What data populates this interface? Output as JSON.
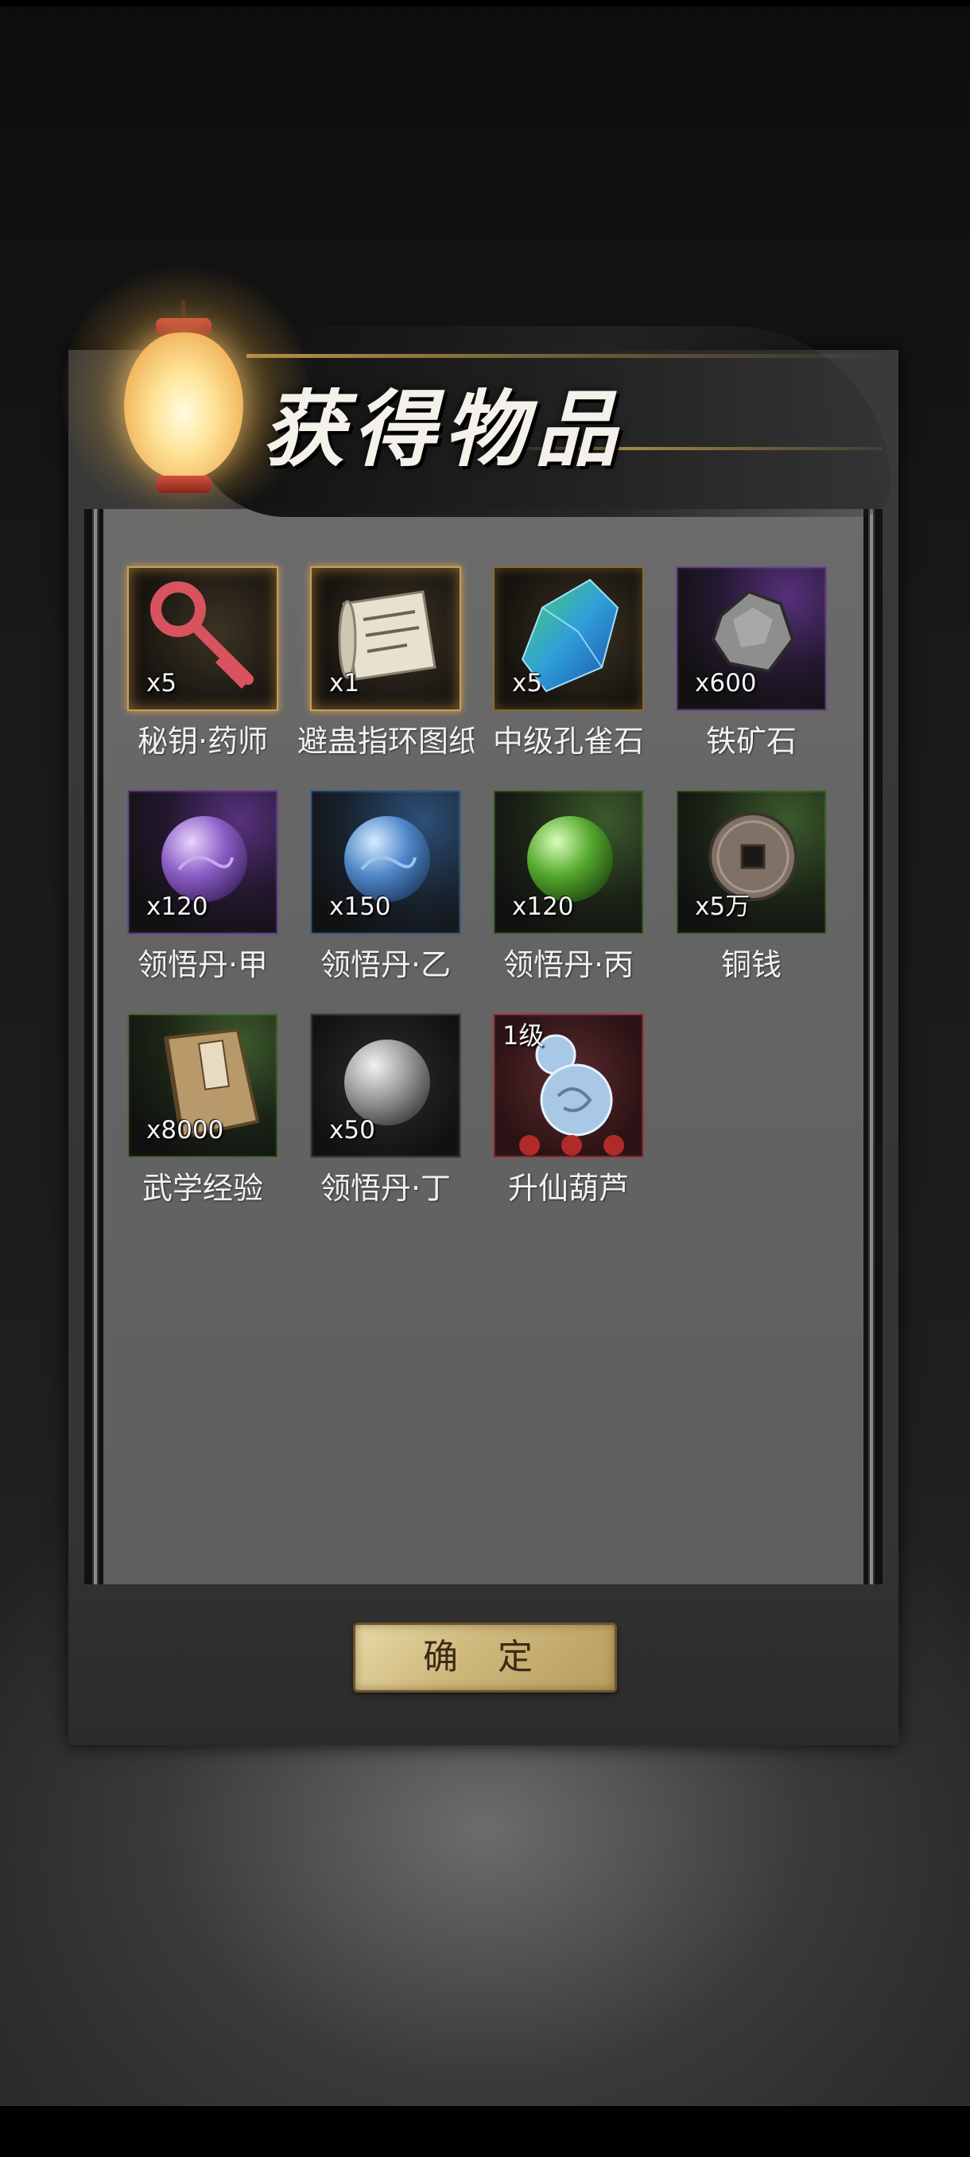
{
  "dialog": {
    "title": "获得物品",
    "confirm_label": "确 定"
  },
  "items": [
    {
      "name": "秘钥·药师",
      "qty": "x5",
      "quality": "gold",
      "icon": "key-icon",
      "accent": "#d9535f"
    },
    {
      "name": "避蛊指环图纸",
      "qty": "x1",
      "quality": "gold",
      "icon": "scroll-icon",
      "accent": "#e8e1d0"
    },
    {
      "name": "中级孔雀石",
      "qty": "x5",
      "quality": "gold",
      "icon": "crystal-icon",
      "accent": "#3fa8d8"
    },
    {
      "name": "铁矿石",
      "qty": "x600",
      "quality": "purple",
      "icon": "iron-ore-icon",
      "accent": "#9a9a9a"
    },
    {
      "name": "领悟丹·甲",
      "qty": "x120",
      "quality": "purple",
      "icon": "pill-icon",
      "accent": "#8a5cc4"
    },
    {
      "name": "领悟丹·乙",
      "qty": "x150",
      "quality": "blue",
      "icon": "pill-icon",
      "accent": "#4f86c8"
    },
    {
      "name": "领悟丹·丙",
      "qty": "x120",
      "quality": "green",
      "icon": "pill-icon",
      "accent": "#55a72e"
    },
    {
      "name": "铜钱",
      "qty": "x5万",
      "quality": "green",
      "icon": "coin-icon",
      "accent": "#8a7c70"
    },
    {
      "name": "武学经验",
      "qty": "x8000",
      "quality": "green",
      "icon": "book-icon",
      "accent": "#b89a6a"
    },
    {
      "name": "领悟丹·丁",
      "qty": "x50",
      "quality": "gray",
      "icon": "pill-icon",
      "accent": "#9a9a9a"
    },
    {
      "name": "升仙葫芦",
      "level": "1级",
      "quality": "red",
      "icon": "gourd-icon",
      "accent": "#a8c8e6"
    }
  ],
  "colors": {
    "gold_border": "#c9a052",
    "purple_border": "#6a4390",
    "blue_border": "#3a5f88",
    "green_border": "#4a6b34",
    "red_border": "#9a3a40",
    "confirm_button": "#cdb77b"
  }
}
